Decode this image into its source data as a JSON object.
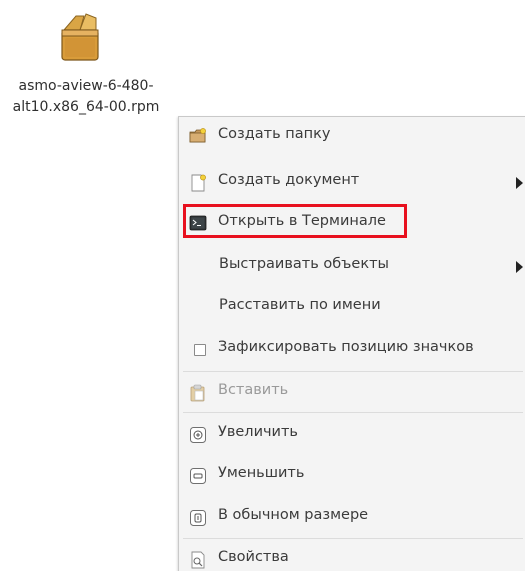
{
  "desktop": {
    "file": {
      "icon": "rpm-package-icon",
      "name_line1": "asmo-aview-6-480-",
      "name_line2": "alt10.x86_64-00.rpm"
    }
  },
  "context_menu": {
    "items": [
      {
        "label": "Создать папку",
        "icon": "folder-new-icon",
        "submenu": false,
        "enabled": true
      },
      {
        "label": "Создать документ",
        "icon": "document-new-icon",
        "submenu": true,
        "enabled": true
      },
      {
        "label": "Открыть в Терминале",
        "icon": "terminal-icon",
        "submenu": false,
        "enabled": true,
        "highlighted": true
      },
      {
        "label": "Выстраивать объекты",
        "icon": null,
        "submenu": true,
        "enabled": true
      },
      {
        "label": "Расставить по имени",
        "icon": null,
        "submenu": false,
        "enabled": true
      },
      {
        "label": "Зафиксировать позицию значков",
        "icon": "checkbox-icon",
        "submenu": false,
        "enabled": true,
        "checked": false
      },
      {
        "label": "Вставить",
        "icon": "paste-icon",
        "submenu": false,
        "enabled": false
      },
      {
        "label": "Увеличить",
        "icon": "zoom-in-icon",
        "submenu": false,
        "enabled": true
      },
      {
        "label": "Уменьшить",
        "icon": "zoom-out-icon",
        "submenu": false,
        "enabled": true
      },
      {
        "label": "В обычном размере",
        "icon": "zoom-original-icon",
        "submenu": false,
        "enabled": true
      },
      {
        "label": "Свойства",
        "icon": "properties-icon",
        "submenu": false,
        "enabled": true
      }
    ],
    "highlight_color": "#e8101e"
  }
}
